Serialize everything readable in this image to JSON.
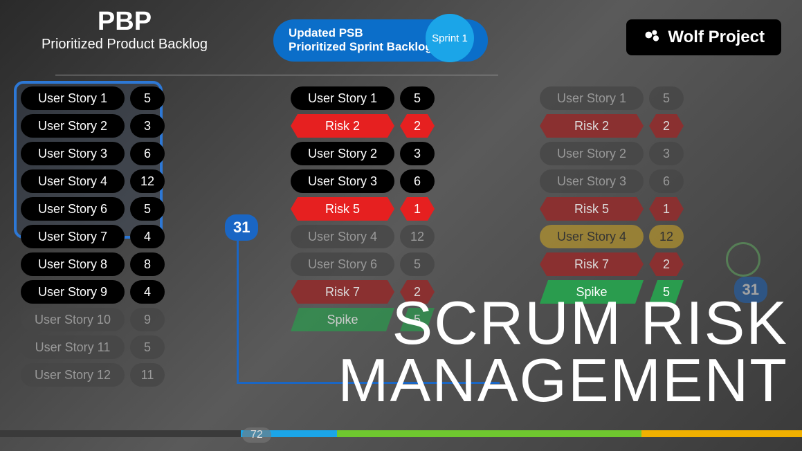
{
  "pbp": {
    "title": "PBP",
    "subtitle": "Prioritized Product Backlog"
  },
  "psb": {
    "line1": "Updated PSB",
    "line2": "Prioritized Sprint Backlog"
  },
  "sprint_label": "Sprint 1",
  "brand": "Wolf Project",
  "velocity": "31",
  "velocity2": "31",
  "play_pos": "72",
  "overlay": {
    "line1": "Scrum Risk",
    "line2": "Management"
  },
  "col1": [
    {
      "type": "story",
      "label": "User Story 1",
      "pts": "5",
      "dim": false
    },
    {
      "type": "story",
      "label": "User Story 2",
      "pts": "3",
      "dim": false
    },
    {
      "type": "story",
      "label": "User Story 3",
      "pts": "6",
      "dim": false
    },
    {
      "type": "story",
      "label": "User Story 4",
      "pts": "12",
      "dim": false
    },
    {
      "type": "story",
      "label": "User Story 6",
      "pts": "5",
      "dim": false
    },
    {
      "type": "story",
      "label": "User Story 7",
      "pts": "4",
      "dim": false
    },
    {
      "type": "story",
      "label": "User Story 8",
      "pts": "8",
      "dim": false
    },
    {
      "type": "story",
      "label": "User Story 9",
      "pts": "4",
      "dim": false
    },
    {
      "type": "story",
      "label": "User Story 10",
      "pts": "9",
      "dim": true
    },
    {
      "type": "story",
      "label": "User Story 11",
      "pts": "5",
      "dim": true
    },
    {
      "type": "story",
      "label": "User Story 12",
      "pts": "11",
      "dim": true
    }
  ],
  "col2": [
    {
      "type": "story",
      "label": "User Story 1",
      "pts": "5",
      "dim": false
    },
    {
      "type": "risk",
      "label": "Risk 2",
      "pts": "2",
      "dim": false
    },
    {
      "type": "story",
      "label": "User Story 2",
      "pts": "3",
      "dim": false
    },
    {
      "type": "story",
      "label": "User Story 3",
      "pts": "6",
      "dim": false
    },
    {
      "type": "risk",
      "label": "Risk 5",
      "pts": "1",
      "dim": false
    },
    {
      "type": "story",
      "label": "User Story 4",
      "pts": "12",
      "dim": true
    },
    {
      "type": "story",
      "label": "User Story 6",
      "pts": "5",
      "dim": true
    },
    {
      "type": "risk",
      "label": "Risk 7",
      "pts": "2",
      "dim": true
    },
    {
      "type": "spike",
      "label": "Spike",
      "pts": "5",
      "dim": true
    }
  ],
  "col3": [
    {
      "type": "story",
      "label": "User Story 1",
      "pts": "5",
      "dim": true
    },
    {
      "type": "risk",
      "label": "Risk 2",
      "pts": "2",
      "dim": true
    },
    {
      "type": "story",
      "label": "User Story 2",
      "pts": "3",
      "dim": true
    },
    {
      "type": "story",
      "label": "User Story 3",
      "pts": "6",
      "dim": true
    },
    {
      "type": "risk",
      "label": "Risk 5",
      "pts": "1",
      "dim": true
    },
    {
      "type": "yellow",
      "label": "User Story 4",
      "pts": "12",
      "dim": true
    },
    {
      "type": "risk",
      "label": "Risk 7",
      "pts": "2",
      "dim": true
    },
    {
      "type": "spike",
      "label": "Spike",
      "pts": "5",
      "dim": false
    }
  ]
}
